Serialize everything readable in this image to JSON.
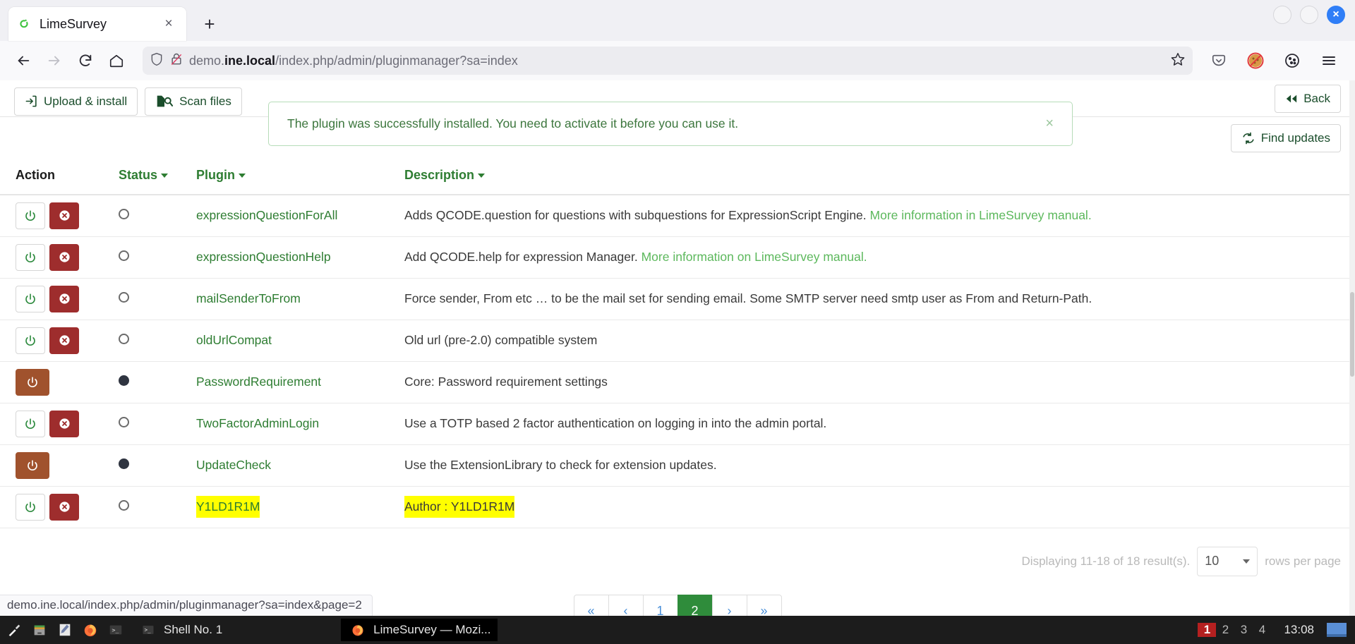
{
  "browser": {
    "tab": {
      "title": "LimeSurvey",
      "favicon": "limesurvey-icon",
      "close_label": "×"
    },
    "new_tab_label": "+",
    "window_controls": {
      "minimize": "",
      "maximize": "",
      "close": "×"
    },
    "nav": {
      "back": "←",
      "forward": "→",
      "reload": "↻",
      "home": "⌂"
    },
    "url": {
      "prefix": "demo.",
      "host_bold": "ine.local",
      "path": "/index.php/admin/pluginmanager?sa=index",
      "shield_icon": "shield-icon",
      "lock_icon": "lock-crossed-icon",
      "bookmark_icon": "star-icon"
    },
    "toolbar_right": [
      "pocket-icon",
      "blocked-cookie-icon",
      "cookie-icon",
      "menu-icon"
    ]
  },
  "page": {
    "toolbar": {
      "upload_install": "Upload & install",
      "scan_files": "Scan files",
      "back": "Back",
      "find_updates": "Find updates"
    },
    "alert": {
      "message": "The plugin was successfully installed. You need to activate it before you can use it.",
      "close": "×"
    },
    "table": {
      "headers": {
        "action": "Action",
        "status": "Status",
        "plugin": "Plugin",
        "description": "Description"
      },
      "rows": [
        {
          "name": "expressionQuestionForAll",
          "active": false,
          "description": "Adds QCODE.question for questions with subquestions for ExpressionScript Engine. ",
          "link": "More information in LimeSurvey manual.",
          "highlight": false
        },
        {
          "name": "expressionQuestionHelp",
          "active": false,
          "description": "Add QCODE.help for expression Manager. ",
          "link": "More information on LimeSurvey manual.",
          "highlight": false
        },
        {
          "name": "mailSenderToFrom",
          "active": false,
          "description": "Force sender, From etc … to be the mail set for sending email. Some SMTP server need smtp user as From and Return-Path.",
          "link": "",
          "highlight": false
        },
        {
          "name": "oldUrlCompat",
          "active": false,
          "description": "Old url (pre-2.0) compatible system",
          "link": "",
          "highlight": false
        },
        {
          "name": "PasswordRequirement",
          "active": true,
          "description": "Core: Password requirement settings",
          "link": "",
          "highlight": false
        },
        {
          "name": "TwoFactorAdminLogin",
          "active": false,
          "description": "Use a TOTP based 2 factor authentication on logging in into the admin portal.",
          "link": "",
          "highlight": false
        },
        {
          "name": "UpdateCheck",
          "active": true,
          "description": "Use the ExtensionLibrary to check for extension updates.",
          "link": "",
          "highlight": false
        },
        {
          "name": "Y1LD1R1M",
          "active": false,
          "description": "Author : Y1LD1R1M",
          "link": "",
          "highlight": true
        }
      ]
    },
    "footer": {
      "displaying": "Displaying 11-18 of 18 result(s).",
      "rows_per_page_value": "10",
      "rows_per_page_label": "rows per page"
    },
    "pagination": {
      "first": "«",
      "prev": "‹",
      "pages": [
        "1",
        "2"
      ],
      "active_page": "2",
      "next": "›",
      "last": "»"
    },
    "status_url": "demo.ine.local/index.php/admin/pluginmanager?sa=index&page=2"
  },
  "taskbar": {
    "icons": [
      "tool-icon",
      "files-icon",
      "editor-icon",
      "firefox-icon",
      "terminal-icon"
    ],
    "shell_item": {
      "icon": "terminal-icon",
      "label": "Shell No. 1"
    },
    "window_item": {
      "icon": "firefox-icon",
      "label": "LimeSurvey — Mozi..."
    },
    "desktops": [
      "1",
      "2",
      "3",
      "4"
    ],
    "current_desktop": "1",
    "clock": "13:08"
  },
  "colors": {
    "green": "#2e7d32",
    "link_green": "#5cb85c",
    "danger": "#9e2d2d",
    "uninstall": "#a0522d",
    "highlight": "#ffff00",
    "pager_active": "#2f8c3b"
  }
}
